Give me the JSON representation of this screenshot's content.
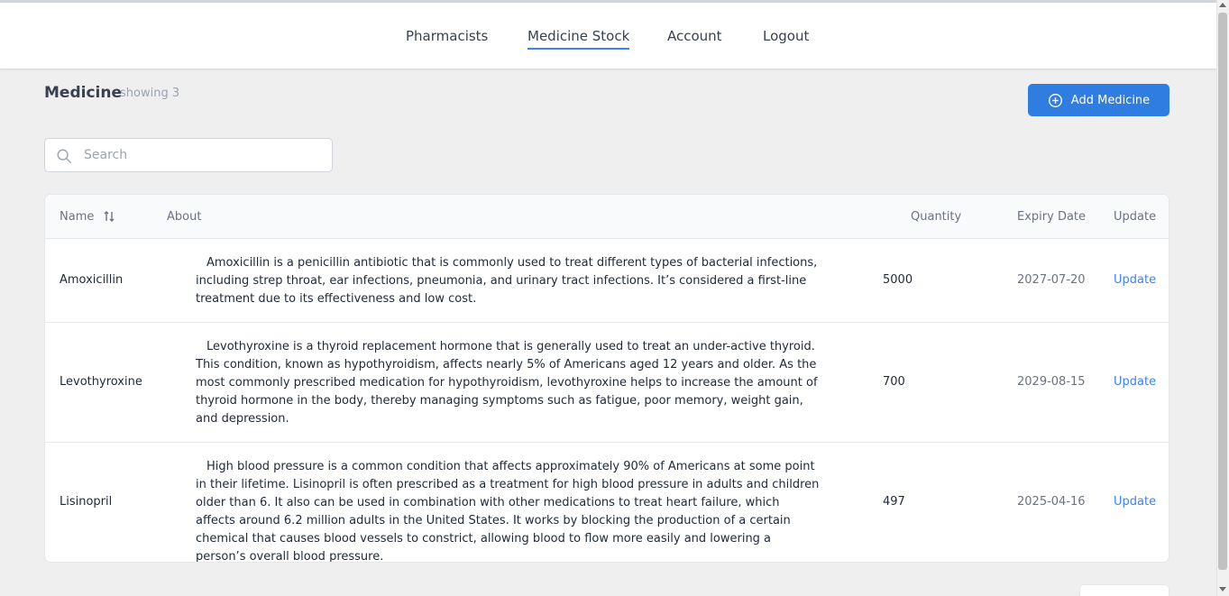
{
  "nav": {
    "items": [
      {
        "label": "Pharmacists",
        "active": false
      },
      {
        "label": "Medicine Stock",
        "active": true
      },
      {
        "label": "Account",
        "active": false
      },
      {
        "label": "Logout",
        "active": false
      }
    ]
  },
  "header": {
    "title": "Medicine",
    "showing": "showing 3",
    "add_button_label": "Add Medicine",
    "add_icon": "plus-circle-icon"
  },
  "search": {
    "placeholder": "Search",
    "value": "",
    "icon": "search-icon"
  },
  "table": {
    "columns": {
      "name": "Name",
      "about": "About",
      "quantity": "Quantity",
      "expiry": "Expiry Date",
      "update": "Update"
    },
    "sort_icon": "sort-icon",
    "rows": [
      {
        "name": "Amoxicillin",
        "about": "Amoxicillin is a penicillin antibiotic that is commonly used to treat different types of bacterial infections, including strep throat, ear infections, pneumonia, and urinary tract infections. It’s considered a first-line treatment due to its effectiveness and low cost.",
        "quantity": "5000",
        "expiry": "2027-07-20",
        "update_label": "Update"
      },
      {
        "name": "Levothyroxine",
        "about": "Levothyroxine is a thyroid replacement hormone that is generally used to treat an under-active thyroid. This condition, known as hypothyroidism, affects nearly 5% of Americans aged 12 years and older. As the most commonly prescribed medication for hypothyroidism, levothyroxine helps to increase the amount of thyroid hormone in the body, thereby managing symptoms such as fatigue, poor memory, weight gain, and depression.",
        "quantity": "700",
        "expiry": "2029-08-15",
        "update_label": "Update"
      },
      {
        "name": "Lisinopril",
        "about": "High blood pressure is a common condition that affects approximately 90% of Americans at some point in their lifetime. Lisinopril is often prescribed as a treatment for high blood pressure in adults and children older than 6. It also can be used in combination with other medications to treat heart failure, which affects around 6.2 million adults in the United States. It works by blocking the production of a certain chemical that causes blood vessels to constrict, allowing blood to flow more easily and lowering a person’s overall blood pressure.",
        "quantity": "497",
        "expiry": "2025-04-16",
        "update_label": "Update"
      }
    ]
  },
  "colors": {
    "accent": "#2f7de1",
    "link": "#3b82f6",
    "background": "#efefef"
  }
}
